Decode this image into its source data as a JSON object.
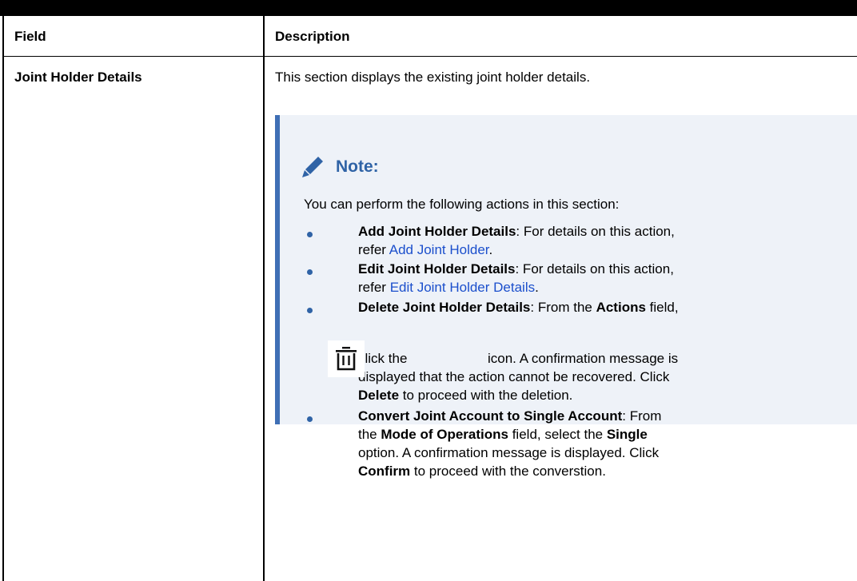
{
  "table": {
    "headers": {
      "field": "Field",
      "description": "Description"
    },
    "row": {
      "field": "Joint Holder Details",
      "description": "This section displays the existing joint holder details."
    }
  },
  "note": {
    "title": "Note:",
    "intro": "You can perform the following actions in this section:",
    "items": [
      {
        "bold": "Add Joint Holder Details",
        "text1": ": For details on this action,",
        "text2_prefix": "refer ",
        "link": "Add Joint Holder",
        "text2_suffix": "."
      },
      {
        "bold": "Edit Joint Holder Details",
        "text1": ": For details on this action,",
        "text2_prefix": "refer ",
        "link": "Edit Joint Holder Details",
        "text2_suffix": "."
      },
      {
        "bold": "Delete Joint Holder Details",
        "text1": ": From the ",
        "bold2": "Actions",
        "text1b": " field,",
        "click_the": "click the",
        "after_icon": "icon. A confirmation message is",
        "line3": "displayed that the action cannot be recovered. Click",
        "line4_bold": "Delete",
        "line4": " to proceed with the deletion."
      },
      {
        "bold": "Convert Joint Account to Single Account",
        "text1": ": From",
        "line2_a": "the ",
        "line2_bold1": "Mode of Operations",
        "line2_b": " field, select the ",
        "line2_bold2": "Single",
        "line3": "option. A confirmation message is displayed. Click",
        "line4_bold": "Confirm",
        "line4": " to proceed with the converstion."
      }
    ],
    "icons": {
      "note_icon": "pencil-icon",
      "delete_icon": "trash-icon"
    },
    "colors": {
      "accent": "#2f63a6",
      "link": "#1b4fcc",
      "note_bg": "#eef2f8",
      "note_border": "#3f6fb5"
    }
  }
}
